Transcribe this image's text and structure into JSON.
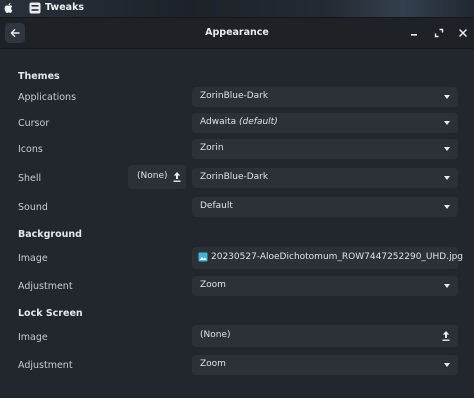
{
  "topbar": {
    "app_name": "Tweaks",
    "sys_icon": "apple-logo-icon",
    "app_icon": "tweaks-app-icon"
  },
  "window": {
    "title": "Appearance"
  },
  "sections": {
    "themes": "Themes",
    "background": "Background",
    "lock_screen": "Lock Screen"
  },
  "themes": {
    "applications": {
      "label": "Applications",
      "value": "ZorinBlue-Dark"
    },
    "cursor": {
      "label": "Cursor",
      "value": "Adwaita",
      "note": "(default)"
    },
    "icons": {
      "label": "Icons",
      "value": "Zorin"
    },
    "shell": {
      "label": "Shell",
      "file": "(None)",
      "value": "ZorinBlue-Dark"
    },
    "sound": {
      "label": "Sound",
      "value": "Default"
    }
  },
  "background": {
    "image": {
      "label": "Image",
      "value": "20230527-AloeDichotomum_ROW7447252290_UHD.jpg"
    },
    "adjustment": {
      "label": "Adjustment",
      "value": "Zoom"
    }
  },
  "lock_screen": {
    "image": {
      "label": "Image",
      "value": "(None)"
    },
    "adjustment": {
      "label": "Adjustment",
      "value": "Zoom"
    }
  },
  "colors": {
    "background": "#22272d",
    "widget": "#2c3137",
    "headerbar": "#1e2227",
    "image_icon_accent": "#3fb5d8"
  }
}
